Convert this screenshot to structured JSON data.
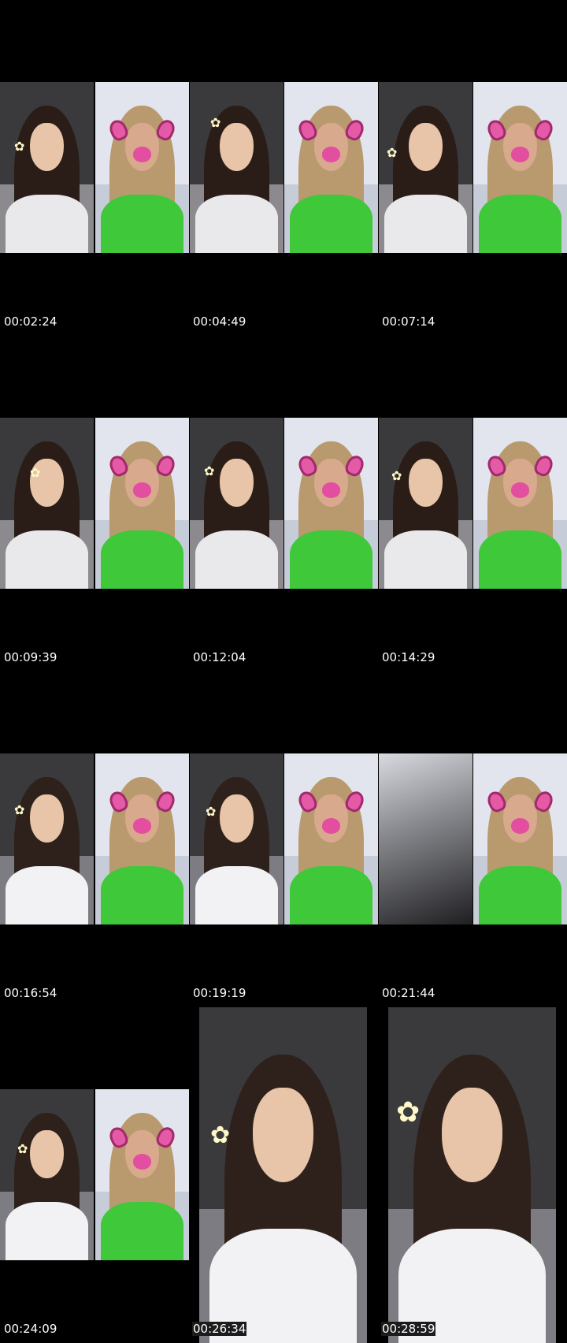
{
  "timestamps": [
    "00:02:24",
    "00:04:49",
    "00:07:14",
    "00:09:39",
    "00:12:04",
    "00:14:29",
    "00:16:54",
    "00:19:19",
    "00:21:44",
    "00:24:09",
    "00:26:34",
    "00:28:59"
  ],
  "flower_icon": "flower-icon",
  "filter_icon": "dog-ears-filter-icon"
}
